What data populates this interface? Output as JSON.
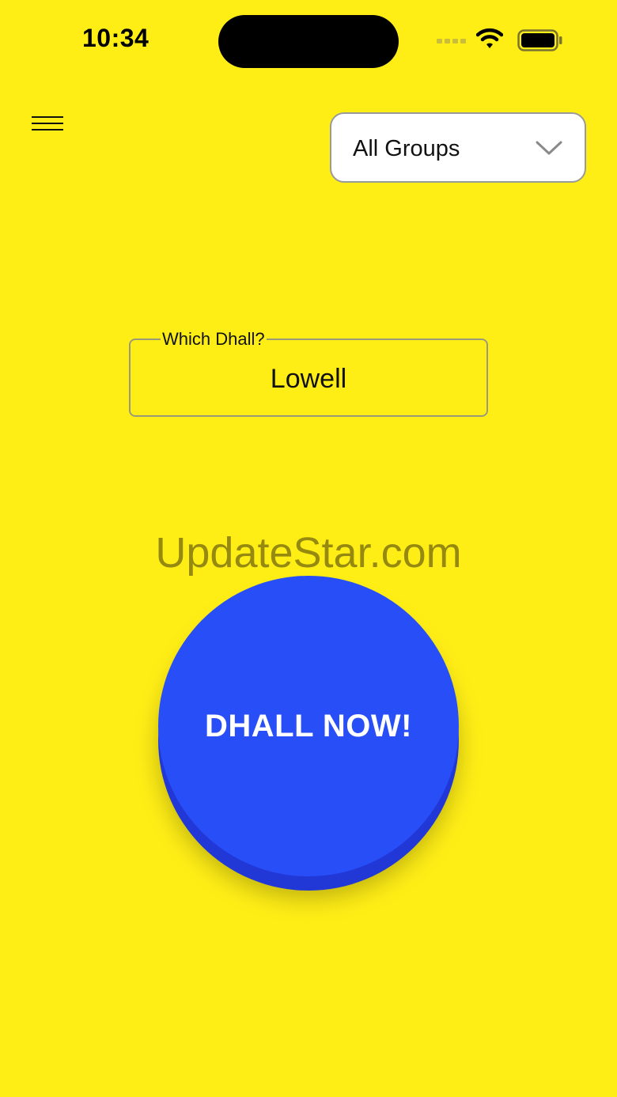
{
  "status_bar": {
    "time": "10:34"
  },
  "header": {
    "menu_icon": "hamburger-menu-icon",
    "group_select": {
      "selected": "All Groups",
      "icon": "chevron-down-icon"
    }
  },
  "dhall_field": {
    "label": "Which Dhall?",
    "value": "Lowell"
  },
  "watermark": "UpdateStar.com",
  "action_button": {
    "label": "DHALL NOW!"
  },
  "colors": {
    "background": "#FFEE16",
    "button": "#284EF7",
    "button_shadow": "#2238D6"
  }
}
